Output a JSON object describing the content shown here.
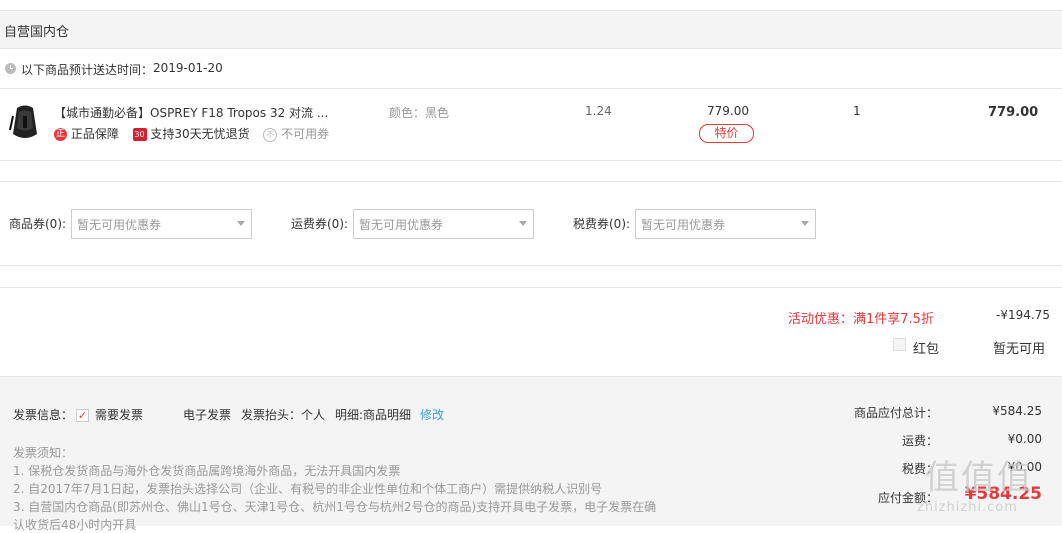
{
  "warehouse": {
    "title": "自营国内仓"
  },
  "delivery": {
    "label": "以下商品预计送达时间：",
    "date": "2019-01-20"
  },
  "product": {
    "name": "【城市通勤必备】OSPREY F18 Tropos 32 对流 ...",
    "color": "颜色：黑色",
    "weight": "1.24",
    "price": "779.00",
    "tag": "特价",
    "quantity": "1",
    "subtotal": "779.00",
    "badges": [
      {
        "icon": "正",
        "label": "正品保障"
      },
      {
        "icon": "30",
        "label": "支持30天无忧退货"
      },
      {
        "icon": "不",
        "label": "不可用券"
      }
    ]
  },
  "coupons": [
    {
      "label": "商品券(0):",
      "placeholder": "暂无可用优惠券"
    },
    {
      "label": "运费券(0):",
      "placeholder": "暂无可用优惠券"
    },
    {
      "label": "税费券(0):",
      "placeholder": "暂无可用优惠券"
    }
  ],
  "promotion": {
    "label": "活动优惠：满1件享7.5折",
    "amount": "-¥194.75"
  },
  "redpacket": {
    "label": "红包",
    "status": "暂无可用"
  },
  "invoice": {
    "label": "发票信息：",
    "need": "需要发票",
    "type": "电子发票",
    "title": "发票抬头：个人",
    "detail": "明细:商品明细",
    "edit": "修改",
    "notice_title": "发票须知：",
    "notices": [
      "1. 保税仓发货商品与海外仓发货商品属跨境海外商品，无法开具国内发票",
      "2. 自2017年7月1日起，发票抬头选择公司（企业、有税号的非企业性单位和个体工商户）需提供纳税人识别号",
      "3. 自营国内仓商品(即苏州仓、佛山1号仓、天津1号仓、杭州1号仓与杭州2号仓的商品)支持开具电子发票，电子发票在确",
      "认收货后48小时内开具"
    ]
  },
  "summary": {
    "items_label": "商品应付总计：",
    "items_value": "¥584.25",
    "shipping_label": "运费：",
    "shipping_value": "¥0.00",
    "tax_label": "税费：",
    "tax_value": "¥0.00",
    "total_label": "应付金额：",
    "total_value": "¥584.25"
  },
  "watermark": {
    "big": "值值值",
    "small": "zhizhizhi.com"
  },
  "colors": {
    "accent": "#e4393c",
    "link": "#3a9fd8",
    "muted": "#999999",
    "panel": "#f4f4f4"
  }
}
